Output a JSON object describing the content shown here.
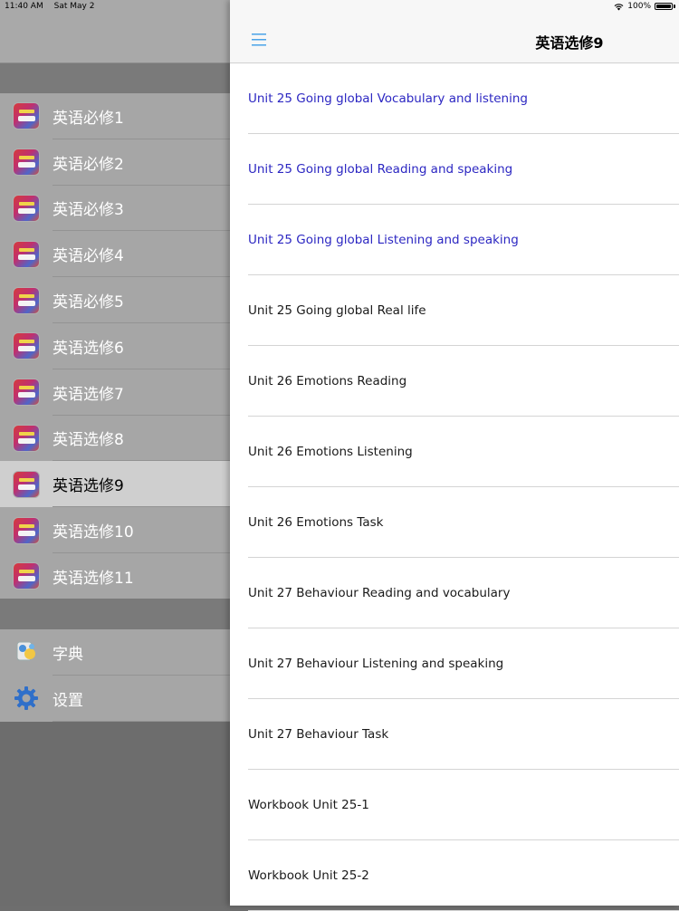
{
  "status_bar": {
    "time": "11:40 AM",
    "date": "Sat May 2",
    "battery": "100%"
  },
  "sidebar": {
    "books": [
      {
        "label": "英语必修1"
      },
      {
        "label": "英语必修2"
      },
      {
        "label": "英语必修3"
      },
      {
        "label": "英语必修4"
      },
      {
        "label": "英语必修5"
      },
      {
        "label": "英语选修6"
      },
      {
        "label": "英语选修7"
      },
      {
        "label": "英语选修8"
      },
      {
        "label": "英语选修9",
        "selected": true
      },
      {
        "label": "英语选修10"
      },
      {
        "label": "英语选修11"
      }
    ],
    "tools": [
      {
        "label": "字典",
        "icon": "dictionary-icon"
      },
      {
        "label": "设置",
        "icon": "gear-icon"
      }
    ]
  },
  "main": {
    "title": "英语选修9",
    "menu_icon": "hamburger-menu-icon",
    "accent_color": "#2c27c2",
    "items": [
      {
        "label": "Unit 25 Going global Vocabulary and listening",
        "visited": true
      },
      {
        "label": "Unit 25 Going global Reading and speaking",
        "visited": true
      },
      {
        "label": "Unit 25 Going global Listening and speaking",
        "visited": true
      },
      {
        "label": "Unit 25 Going global Real life",
        "visited": false
      },
      {
        "label": "Unit 26 Emotions Reading",
        "visited": false
      },
      {
        "label": "Unit 26 Emotions Listening",
        "visited": false
      },
      {
        "label": "Unit 26 Emotions Task",
        "visited": false
      },
      {
        "label": "Unit 27 Behaviour Reading and vocabulary",
        "visited": false
      },
      {
        "label": "Unit 27 Behaviour Listening and speaking",
        "visited": false
      },
      {
        "label": "Unit 27 Behaviour Task",
        "visited": false
      },
      {
        "label": "Workbook Unit 25-1",
        "visited": false
      },
      {
        "label": "Workbook Unit 25-2",
        "visited": false
      }
    ]
  }
}
